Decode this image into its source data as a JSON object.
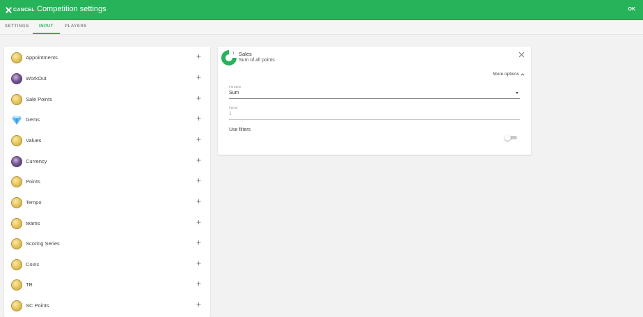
{
  "header": {
    "cancel_label": "CANCEL",
    "title": "Competition settings",
    "ok_label": "OK",
    "brand_color": "#27b35a"
  },
  "tabs": [
    {
      "label": "SETTINGS",
      "active": false
    },
    {
      "label": "INPUT",
      "active": true
    },
    {
      "label": "PLAYERS",
      "active": false
    }
  ],
  "inputs": [
    {
      "label": "Appointments",
      "icon": "coin-icon"
    },
    {
      "label": "WorkOut",
      "icon": "avatar-photo-icon"
    },
    {
      "label": "Sale Points",
      "icon": "coin-icon"
    },
    {
      "label": "Gems",
      "icon": "gem-icon"
    },
    {
      "label": "Values",
      "icon": "coin-icon"
    },
    {
      "label": "Currency",
      "icon": "avatar-photo-icon"
    },
    {
      "label": "Points",
      "icon": "coin-icon"
    },
    {
      "label": "Tempo",
      "icon": "coin-icon"
    },
    {
      "label": "teams",
      "icon": "coin-icon"
    },
    {
      "label": "Scoring Series",
      "icon": "coin-icon"
    },
    {
      "label": "Coins",
      "icon": "coin-icon"
    },
    {
      "label": "TB",
      "icon": "coin-icon"
    },
    {
      "label": "SC Points",
      "icon": "coin-icon"
    }
  ],
  "add_symbol": "+",
  "selected_input": {
    "number": "1",
    "title": "Sales",
    "subtitle": "Sum of all points",
    "more_options_label": "More options",
    "function_field": {
      "label": "Function",
      "value": "Sum"
    },
    "factor_field": {
      "label": "Factor",
      "value": "1"
    },
    "filters_label": "Use filters",
    "filters_enabled": false
  }
}
